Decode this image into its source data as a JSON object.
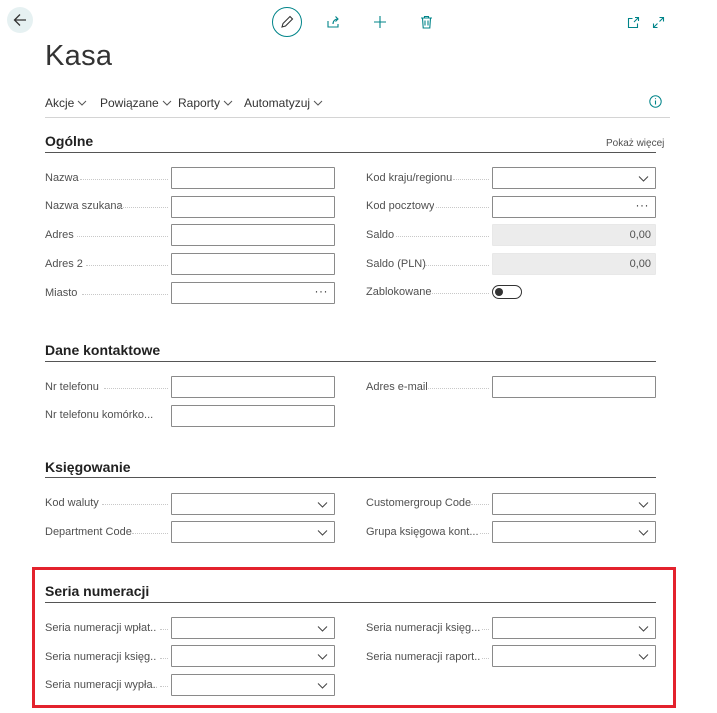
{
  "page": {
    "title": "Kasa",
    "show_more": "Pokaż więcej"
  },
  "icons": {
    "back": "arrow-left-icon",
    "edit": "pencil-icon",
    "share": "share-icon",
    "add": "plus-icon",
    "delete": "trash-icon",
    "open_new": "open-in-new-window-icon",
    "expand": "expand-icon",
    "info": "info-icon"
  },
  "accent_color": "#008489",
  "highlight_color": "#e3222d",
  "menu": [
    {
      "label": "Akcje"
    },
    {
      "label": "Powiązane"
    },
    {
      "label": "Raporty"
    },
    {
      "label": "Automatyzuj"
    }
  ],
  "sections": {
    "general": {
      "title": "Ogólne",
      "left": [
        {
          "label": "Nazwa",
          "value": ""
        },
        {
          "label": "Nazwa szukana",
          "value": ""
        },
        {
          "label": "Adres",
          "value": ""
        },
        {
          "label": "Adres 2",
          "value": ""
        },
        {
          "label": "Miasto",
          "value": ""
        }
      ],
      "right": [
        {
          "label": "Kod kraju/regionu",
          "value": ""
        },
        {
          "label": "Kod pocztowy",
          "value": ""
        },
        {
          "label": "Saldo",
          "value": "0,00"
        },
        {
          "label": "Saldo (PLN)",
          "value": "0,00"
        },
        {
          "label": "Zablokowane",
          "value": "off"
        }
      ]
    },
    "contact": {
      "title": "Dane kontaktowe",
      "left": [
        {
          "label": "Nr telefonu",
          "value": ""
        },
        {
          "label": "Nr telefonu komórko...",
          "value": ""
        }
      ],
      "right": [
        {
          "label": "Adres e-mail",
          "value": ""
        }
      ]
    },
    "posting": {
      "title": "Księgowanie",
      "left": [
        {
          "label": "Kod waluty",
          "value": ""
        },
        {
          "label": "Department Code",
          "value": ""
        }
      ],
      "right": [
        {
          "label": "Customergroup Code",
          "value": ""
        },
        {
          "label": "Grupa księgowa kont...",
          "value": ""
        }
      ]
    },
    "numbering": {
      "title": "Seria numeracji",
      "left": [
        {
          "label": "Seria numeracji wpłat...",
          "value": ""
        },
        {
          "label": "Seria numeracji księg...",
          "value": ""
        },
        {
          "label": "Seria numeracji wypła...",
          "value": ""
        }
      ],
      "right": [
        {
          "label": "Seria numeracji księg...",
          "value": ""
        },
        {
          "label": "Seria numeracji raport...",
          "value": ""
        }
      ]
    }
  }
}
